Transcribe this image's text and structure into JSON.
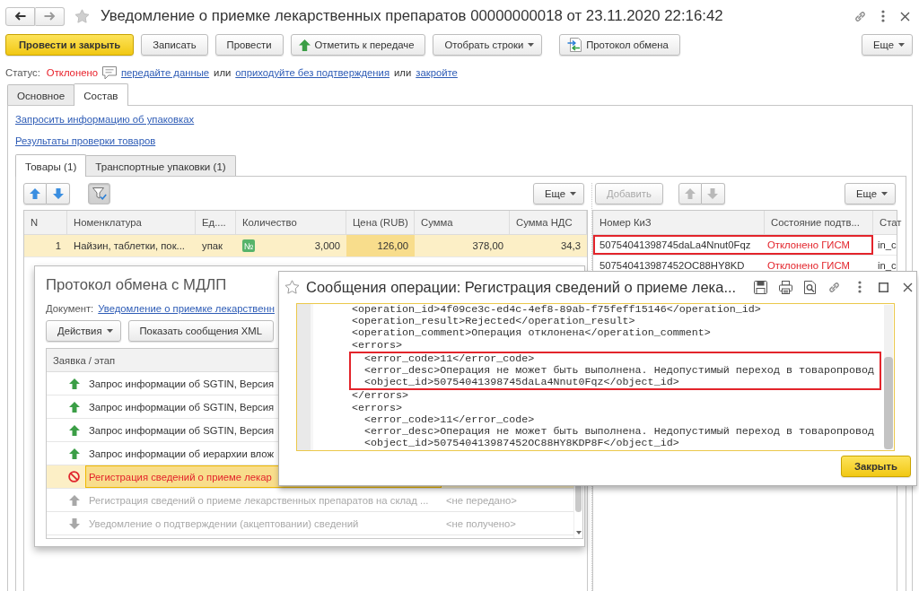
{
  "window": {
    "title": "Уведомление о приемке лекарственных препаратов 00000000018 от 23.11.2020 22:16:42"
  },
  "toolbar": [
    {
      "label": "Провести и закрыть",
      "kind": "primary"
    },
    {
      "label": "Записать",
      "kind": "plain"
    },
    {
      "label": "Провести",
      "kind": "plain"
    },
    {
      "label": "Отметить к передаче",
      "kind": "send"
    },
    {
      "label": "Отобрать строки",
      "kind": "menu"
    },
    {
      "label": "Протокол обмена",
      "kind": "log"
    },
    {
      "label": "Еще",
      "kind": "more"
    }
  ],
  "status": {
    "label": "Статус:",
    "value": "Отклонено",
    "parts": [
      {
        "kind": "link",
        "text": "передайте данные"
      },
      {
        "kind": "text",
        "text": "или"
      },
      {
        "kind": "link",
        "text": "оприходуйте без подтверждения"
      },
      {
        "kind": "text",
        "text": "или"
      },
      {
        "kind": "link",
        "text": "закройте"
      }
    ]
  },
  "tabs": [
    {
      "label": "Основное",
      "selected": false
    },
    {
      "label": "Состав",
      "selected": true
    }
  ],
  "links": [
    "Запросить информацию об упаковках",
    "Результаты проверки товаров"
  ],
  "subtabs": [
    {
      "label": "Товары (1)",
      "selected": true
    },
    {
      "label": "Транспортные упаковки (1)",
      "selected": false
    }
  ],
  "goods": {
    "filter": {
      "on": true
    },
    "more": "Еще",
    "columns": [
      "N",
      "Номенклатура",
      "Ед....",
      "Количество",
      "Цена (RUB)",
      "Сумма",
      "Сумма НДС"
    ],
    "rows": [
      {
        "selected": true,
        "cells": [
          {
            "text": "1",
            "current": false
          },
          {
            "text": "Найзин, таблетки, пок...",
            "current": false
          },
          {
            "text": "упак",
            "current": false
          },
          {
            "text": "3,000",
            "badge": "№",
            "current": false
          },
          {
            "text": "126,00",
            "current": true
          },
          {
            "text": "378,00",
            "current": false
          },
          {
            "text": "34,3",
            "current": false
          }
        ]
      }
    ]
  },
  "codes": {
    "add": {
      "label": "Добавить",
      "disabled": true
    },
    "move": {
      "disabled": true
    },
    "more": "Еще",
    "columns": [
      "Номер КиЗ",
      "Состояние подтв...",
      "Стат"
    ],
    "rows": [
      {
        "highlighted": true,
        "rejected": true,
        "cells": [
          "50754041398745daLa4Nnut0Fqz",
          "Отклонено ГИСМ",
          "in_c"
        ]
      },
      {
        "highlighted": false,
        "rejected": true,
        "cells": [
          "507540413987452OC88HY8KD",
          "Отклонено ГИСМ",
          "in_c"
        ]
      }
    ]
  },
  "protocol": {
    "title": "Протокол обмена с МДЛП",
    "document_label": "Документ:",
    "document_link": "Уведомление о приемке лекарственн",
    "buttons": [
      {
        "label": "Действия",
        "kind": "menu"
      },
      {
        "label": "Показать сообщения XML",
        "kind": "plain"
      }
    ],
    "column": "Заявка / этап",
    "rows": [
      {
        "kind": "sent",
        "selected": false,
        "text": "Запрос информации об SGTIN, Версия"
      },
      {
        "kind": "sent",
        "selected": false,
        "text": "Запрос информации об SGTIN, Версия"
      },
      {
        "kind": "sent",
        "selected": false,
        "text": "Запрос информации об SGTIN, Версия"
      },
      {
        "kind": "sent",
        "selected": false,
        "text": "Запрос информации об иерархии влож"
      },
      {
        "kind": "failed",
        "selected": true,
        "text": "Регистрация сведений о приеме лекар"
      },
      {
        "kind": "waiting_send",
        "selected": false,
        "text": "Регистрация сведений о приеме лекарственных препаратов на склад ...",
        "status": "<не передано>"
      },
      {
        "kind": "waiting_receive",
        "selected": false,
        "text": "Уведомление о подтверждении (акцептовании) сведений",
        "status": "<не получено>"
      }
    ]
  },
  "message": {
    "title": "Сообщения операции: Регистрация сведений о приеме лека...",
    "lines": [
      {
        "text": "<operation_id>4f09ce3c-ed4c-4ef8-89ab-f75feff15146</operation_id>",
        "marked": false
      },
      {
        "text": "<operation_result>Rejected</operation_result>",
        "marked": false
      },
      {
        "text": "<operation_comment>Операция отклонена</operation_comment>",
        "marked": false
      },
      {
        "text": "<errors>",
        "marked": false,
        "children": [
          {
            "text": "<error_code>11</error_code>",
            "marked": true
          },
          {
            "text": "<error_desc>Операция не может быть выполнена. Недопустимый переход в товаропровод",
            "marked": true
          },
          {
            "text": "<object_id>50754041398745daLa4Nnut0Fqz</object_id>",
            "marked": true
          }
        ]
      },
      {
        "text": "</errors>",
        "marked": false
      },
      {
        "text": "<errors>",
        "marked": false,
        "children": [
          {
            "text": "<error_code>11</error_code>",
            "marked": false
          },
          {
            "text": "<error_desc>Операция не может быть выполнена. Недопустимый переход в товаропровод",
            "marked": false
          },
          {
            "text": "<object_id>507540413987452OC88HY8KDP8F</object_id>",
            "marked": false
          }
        ]
      }
    ],
    "close": "Закрыть"
  }
}
